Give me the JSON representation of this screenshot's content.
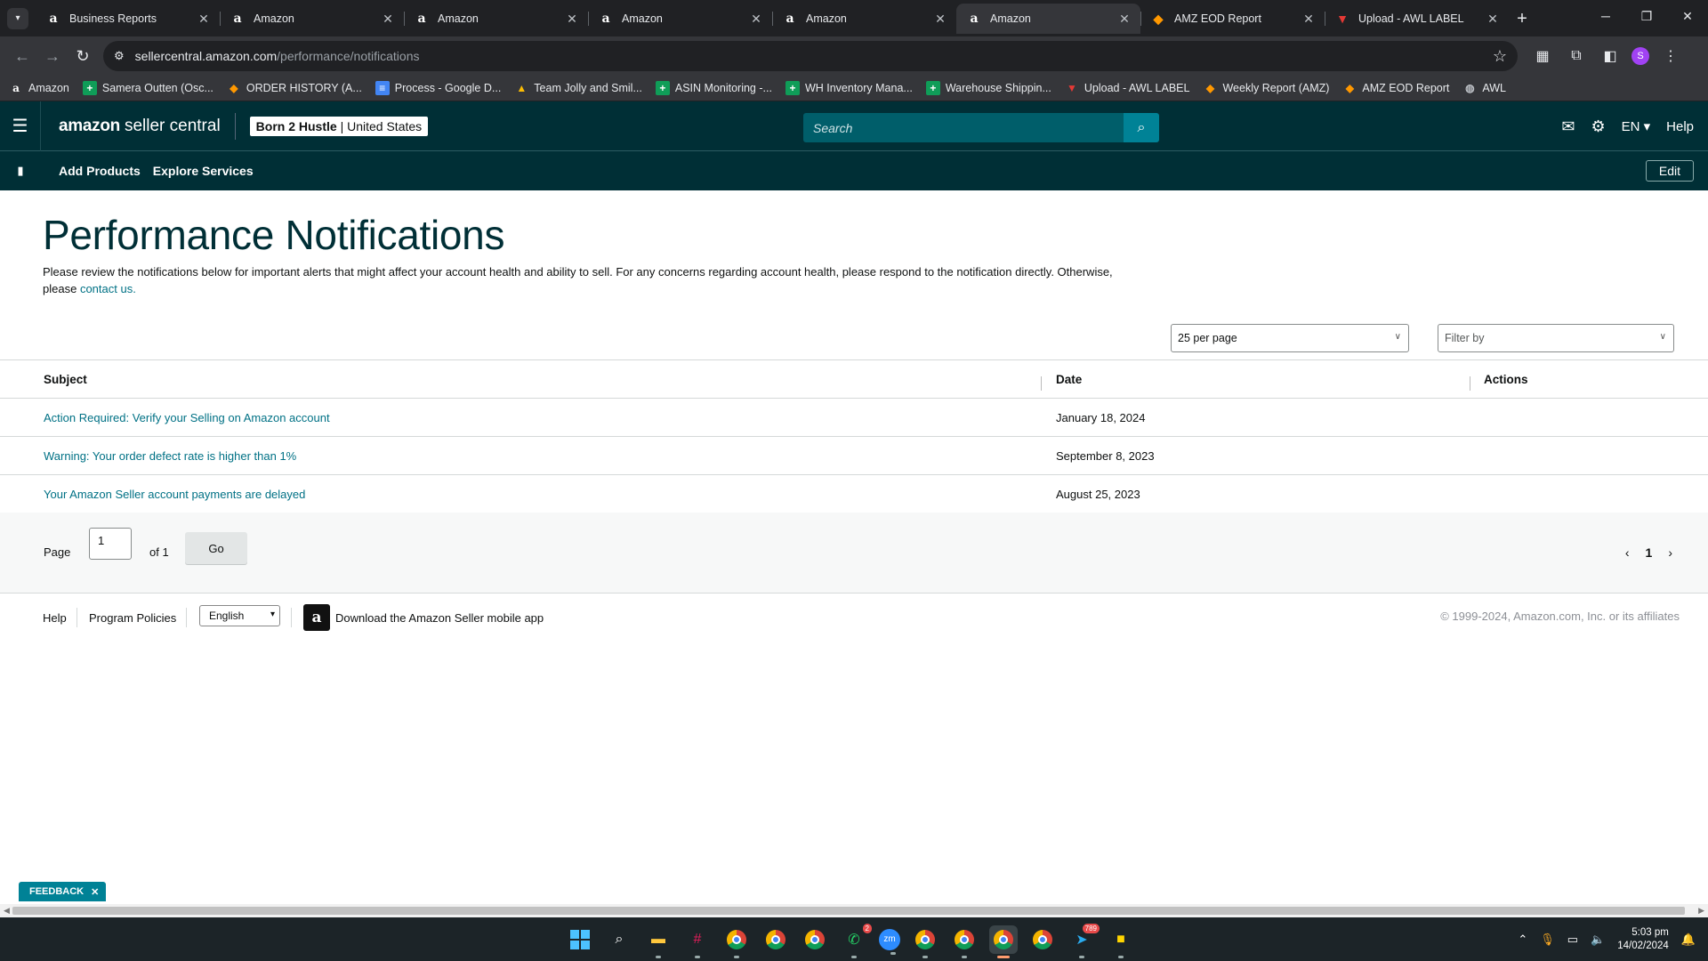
{
  "browser": {
    "tabs": [
      {
        "title": "Business Reports",
        "icon": "amazon-icon",
        "active": false
      },
      {
        "title": "Amazon",
        "icon": "amazon-icon",
        "active": false
      },
      {
        "title": "Amazon",
        "icon": "amazon-icon",
        "active": false
      },
      {
        "title": "Amazon",
        "icon": "amazon-icon",
        "active": false
      },
      {
        "title": "Amazon",
        "icon": "amazon-icon",
        "active": false
      },
      {
        "title": "Amazon",
        "icon": "amazon-icon",
        "active": true
      },
      {
        "title": "AMZ EOD Report",
        "icon": "eod-report-icon",
        "active": false
      },
      {
        "title": "Upload - AWL LABEL",
        "icon": "awl-icon",
        "active": false
      }
    ],
    "url_host": "sellercentral.amazon.com",
    "url_path": "/performance/notifications",
    "profile_initial": "S",
    "bookmarks": [
      {
        "label": "Amazon",
        "icon": "amazon"
      },
      {
        "label": "Samera Outten (Osc...",
        "icon": "sheet"
      },
      {
        "label": "ORDER HISTORY (A...",
        "icon": "orange"
      },
      {
        "label": "Process - Google D...",
        "icon": "doc"
      },
      {
        "label": "Team Jolly and Smil...",
        "icon": "drive"
      },
      {
        "label": "ASIN Monitoring -...",
        "icon": "sheet"
      },
      {
        "label": "WH Inventory Mana...",
        "icon": "sheet"
      },
      {
        "label": "Warehouse Shippin...",
        "icon": "sheet"
      },
      {
        "label": "Upload - AWL LABEL",
        "icon": "red"
      },
      {
        "label": "Weekly Report (AMZ)",
        "icon": "orange"
      },
      {
        "label": "AMZ EOD Report",
        "icon": "orange"
      },
      {
        "label": "AWL",
        "icon": "globe"
      }
    ]
  },
  "header": {
    "logo_bold": "amazon",
    "logo_light": "seller central",
    "store_name": "Born 2 Hustle",
    "marketplace": "United States",
    "search_placeholder": "Search",
    "language": "EN",
    "help": "Help"
  },
  "subnav": {
    "links": [
      "Add Products",
      "Explore Services"
    ],
    "edit": "Edit"
  },
  "page": {
    "title": "Performance Notifications",
    "description": "Please review the notifications below for important alerts that might affect your account health and ability to sell. For any concerns regarding account health, please respond to the notification directly. Otherwise, please",
    "contact_link": "contact us.",
    "per_page": "25 per page",
    "filter_placeholder": "Filter by"
  },
  "table": {
    "headers": {
      "subject": "Subject",
      "date": "Date",
      "actions": "Actions"
    },
    "rows": [
      {
        "subject": "Action Required: Verify your Selling on Amazon account",
        "date": "January 18, 2024"
      },
      {
        "subject": "Warning: Your order defect rate is higher than 1%",
        "date": "September 8, 2023"
      },
      {
        "subject": "Your Amazon Seller account payments are delayed",
        "date": "August 25, 2023"
      }
    ]
  },
  "pagination": {
    "page_label": "Page",
    "page_value": "1",
    "of_label": "of 1",
    "go": "Go",
    "current": "1"
  },
  "footer": {
    "help": "Help",
    "policies": "Program Policies",
    "language": "English",
    "app_text": "Download the Amazon Seller mobile app",
    "copyright": "© 1999-2024, Amazon.com, Inc. or its affiliates"
  },
  "feedback": "FEEDBACK",
  "taskbar": {
    "time": "5:03 pm",
    "date": "14/02/2024",
    "badges": {
      "whatsapp": "2",
      "telegram": "789"
    }
  }
}
